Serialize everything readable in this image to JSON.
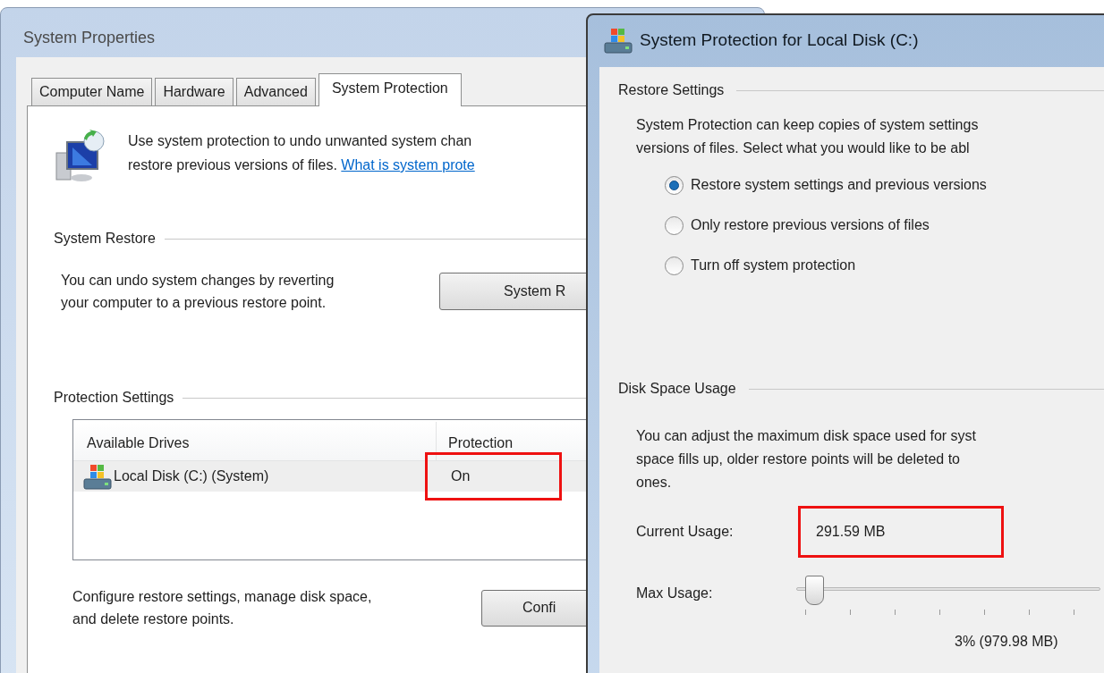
{
  "system_properties": {
    "title": "System Properties",
    "tabs": [
      {
        "label": "Computer Name",
        "selected": false
      },
      {
        "label": "Hardware",
        "selected": false
      },
      {
        "label": "Advanced",
        "selected": false
      },
      {
        "label": "System Protection",
        "selected": true
      }
    ],
    "intro": {
      "lines": [
        "Use system protection to undo unwanted system chan",
        "restore previous versions of files."
      ],
      "link": "What is system prote"
    },
    "system_restore": {
      "heading": "System Restore",
      "lines": [
        "You can undo system changes by reverting",
        "your computer to a previous restore point."
      ],
      "button": "System R"
    },
    "protection_settings": {
      "heading": "Protection Settings",
      "columns": [
        "Available Drives",
        "Protection"
      ],
      "rows": [
        {
          "drive": "Local Disk (C:) (System)",
          "protection": "On",
          "selected": true,
          "highlighted": true
        }
      ],
      "lines": [
        "Configure restore settings, manage disk space,",
        "and delete restore points."
      ],
      "button": "Confi"
    }
  },
  "protection_dialog": {
    "title": "System Protection for Local Disk (C:)",
    "restore_settings": {
      "heading": "Restore Settings",
      "lines": [
        "System Protection can keep copies of system settings",
        "versions of files. Select what you would like to be abl"
      ],
      "options": [
        {
          "label": "Restore system settings and previous versions",
          "selected": true
        },
        {
          "label": "Only restore previous versions of files",
          "selected": false
        },
        {
          "label": "Turn off system protection",
          "selected": false
        }
      ]
    },
    "disk_space_usage": {
      "heading": "Disk Space Usage",
      "lines": [
        "You can adjust the maximum disk space used for syst",
        "space fills up, older restore points will be deleted to",
        "ones."
      ],
      "current_usage": {
        "label": "Current Usage:",
        "value": "291.59 MB",
        "highlighted": true
      },
      "max_usage": {
        "label": "Max Usage:",
        "level": 0.03,
        "reading": "3% (979.98 MB)"
      }
    }
  }
}
